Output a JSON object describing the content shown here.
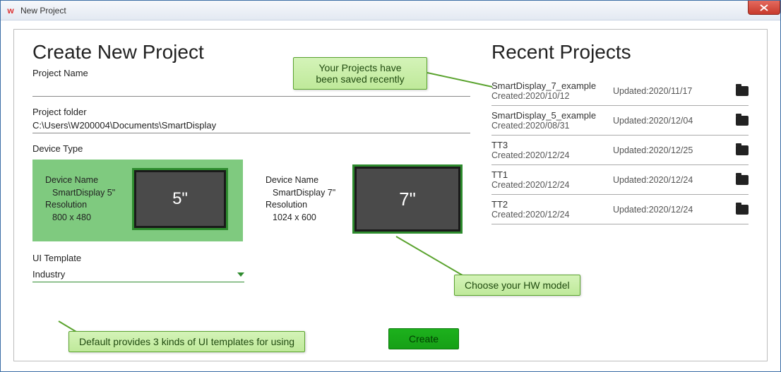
{
  "window": {
    "title": "New Project"
  },
  "left": {
    "heading": "Create New Project",
    "project_name_label": "Project Name",
    "project_name_value": "",
    "project_folder_label": "Project folder",
    "project_folder_value": "C:\\Users\\W200004\\Documents\\SmartDisplay",
    "device_type_label": "Device Type",
    "devices": [
      {
        "name_label": "Device Name",
        "name": "SmartDisplay 5\"",
        "res_label": "Resolution",
        "res": "800 x 480",
        "screen": "5\""
      },
      {
        "name_label": "Device Name",
        "name": "SmartDisplay 7\"",
        "res_label": "Resolution",
        "res": "1024 x 600",
        "screen": "7\""
      }
    ],
    "ui_template_label": "UI Template",
    "ui_template_value": "Industry",
    "create_label": "Create"
  },
  "right": {
    "heading": "Recent Projects",
    "created_prefix": "Created:",
    "updated_prefix": "Updated:",
    "items": [
      {
        "name": "SmartDisplay_7_example",
        "created": "2020/10/12",
        "updated": "2020/11/17"
      },
      {
        "name": "SmartDisplay_5_example",
        "created": "2020/08/31",
        "updated": "2020/12/04"
      },
      {
        "name": "TT3",
        "created": "2020/12/24",
        "updated": "2020/12/25"
      },
      {
        "name": "TT1",
        "created": "2020/12/24",
        "updated": "2020/12/24"
      },
      {
        "name": "TT2",
        "created": "2020/12/24",
        "updated": "2020/12/24"
      }
    ]
  },
  "annotations": {
    "recent": "Your Projects have\nbeen saved recently",
    "hw": "Choose your HW model",
    "templates": "Default provides 3 kinds of UI templates for using"
  }
}
